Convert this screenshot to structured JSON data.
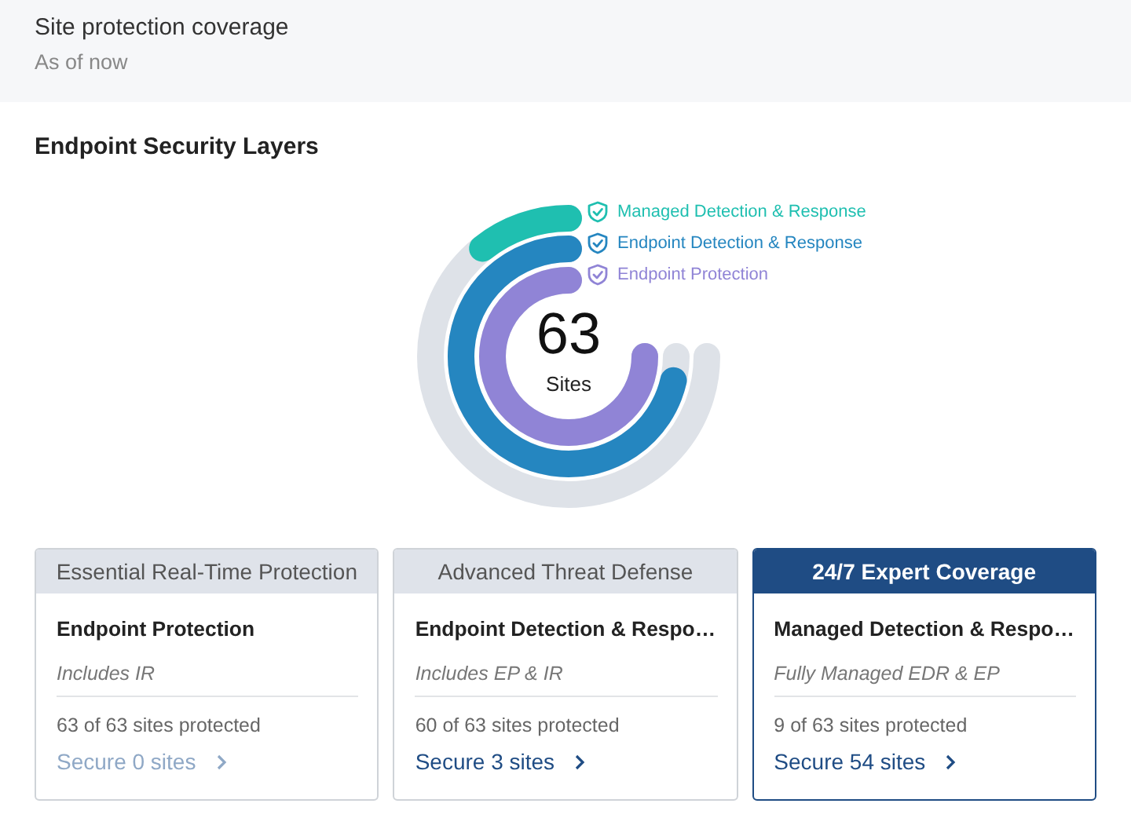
{
  "header": {
    "title": "Site protection coverage",
    "subtitle": "As of now"
  },
  "section": {
    "title": "Endpoint Security Layers"
  },
  "chart": {
    "total": "63",
    "unit": "Sites",
    "rings": [
      {
        "name": "Managed Detection & Response",
        "color": "#1fbfb0"
      },
      {
        "name": "Endpoint Detection & Response",
        "color": "#2586c0"
      },
      {
        "name": "Endpoint Protection",
        "color": "#9084d6"
      }
    ]
  },
  "cards": [
    {
      "tier": "Essential Real-Time Protection",
      "selected": false,
      "title": "Endpoint Protection",
      "note": "Includes IR",
      "count": "63 of 63 sites protected",
      "link": "Secure 0 sites",
      "disabled": true
    },
    {
      "tier": "Advanced Threat Defense",
      "selected": false,
      "title": "Endpoint Detection & Respo…",
      "note": "Includes EP & IR",
      "count": "60 of 63 sites protected",
      "link": "Secure 3 sites",
      "disabled": false
    },
    {
      "tier": "24/7 Expert Coverage",
      "selected": true,
      "title": "Managed Detection & Respo…",
      "note": "Fully Managed EDR & EP",
      "count": "9 of 63 sites protected",
      "link": "Secure 54 sites",
      "disabled": false
    }
  ]
}
